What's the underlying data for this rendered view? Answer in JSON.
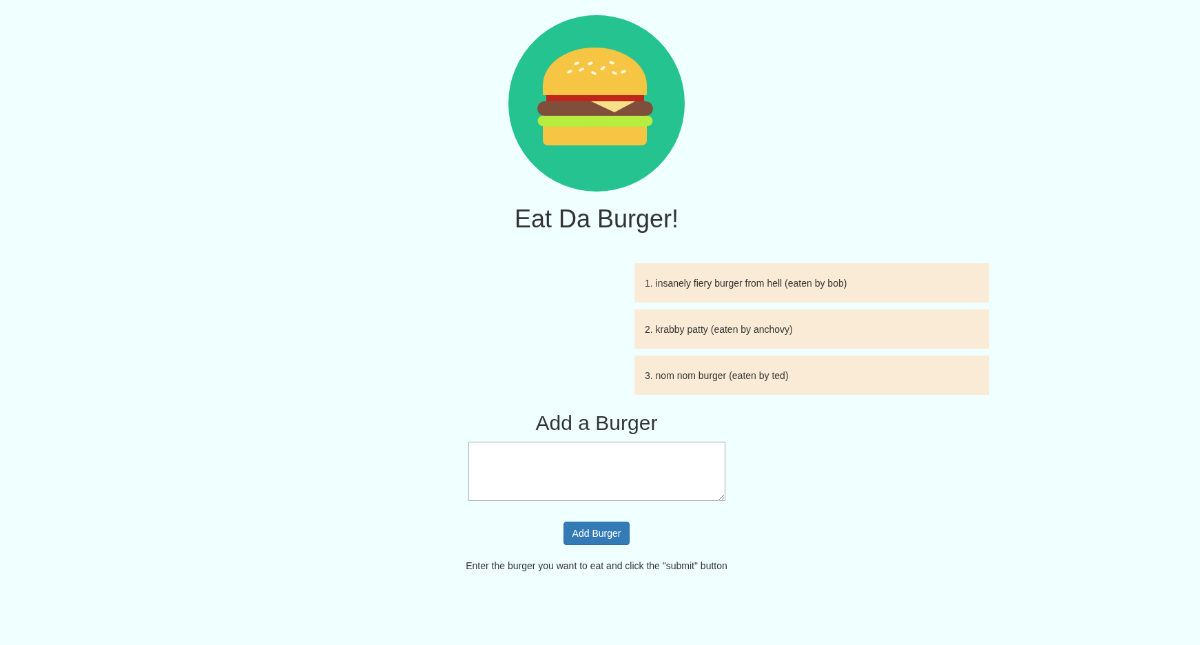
{
  "title": "Eat Da Burger!",
  "eaten_burgers": [
    {
      "text": "1. insanely fiery burger from hell (eaten by bob)"
    },
    {
      "text": "2. krabby patty (eaten by anchovy)"
    },
    {
      "text": "3. nom nom burger (eaten by ted)"
    }
  ],
  "add_form": {
    "heading": "Add a Burger",
    "button": "Add Burger",
    "hint": "Enter the burger you want to eat and click the \"submit\" button"
  }
}
